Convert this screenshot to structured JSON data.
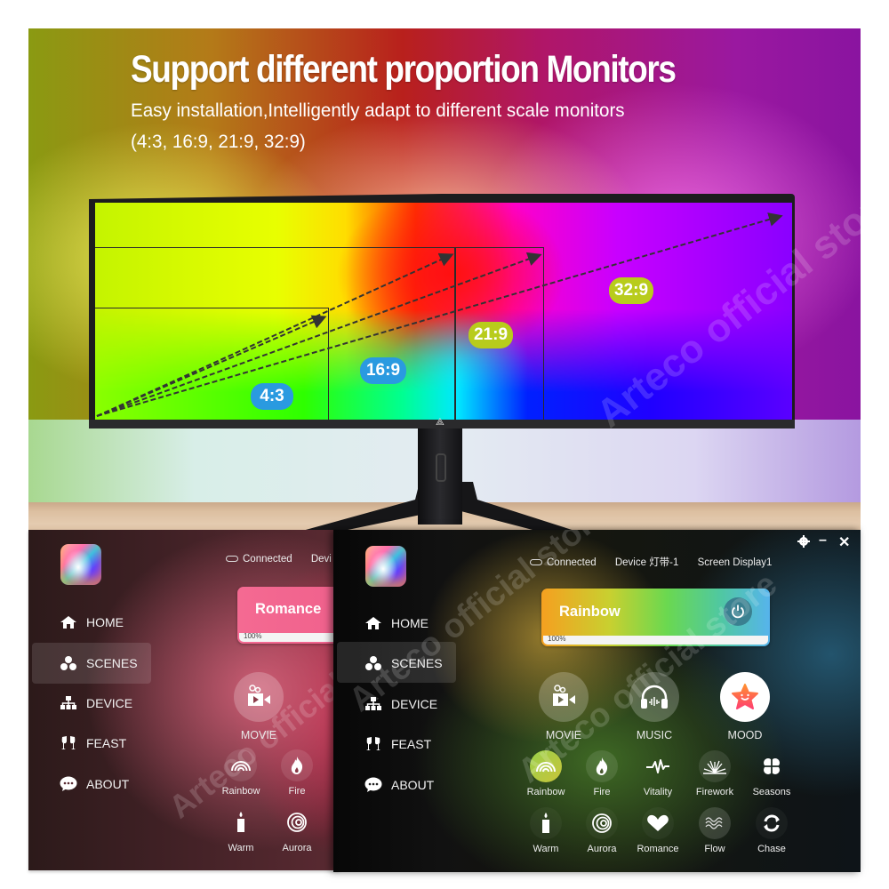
{
  "hero": {
    "title": "Support different proportion Monitors",
    "subtitle_line1": "Easy installation,Intelligently adapt to different scale monitors",
    "subtitle_line2": "(4:3, 16:9, 21:9, 32:9)",
    "watermark": "Arteco official store",
    "ratios": [
      {
        "label": "4:3",
        "color": "#2a9ae0"
      },
      {
        "label": "16:9",
        "color": "#2a9ae0"
      },
      {
        "label": "21:9",
        "color": "#b8cc1c"
      },
      {
        "label": "32:9",
        "color": "#b8cc1c"
      }
    ]
  },
  "app_left": {
    "status": {
      "connected": "Connected",
      "device_partial": "Devi"
    },
    "nav": [
      "HOME",
      "SCENES",
      "DEVICE",
      "FEAST",
      "ABOUT"
    ],
    "active_nav": "SCENES",
    "card": {
      "title": "Romance",
      "brightness": "100%",
      "color": "#f0608c"
    },
    "big_modes": [
      "MOVIE"
    ],
    "small_modes_row1": [
      "Rainbow",
      "Fire"
    ],
    "small_modes_row2": [
      "Warm",
      "Aurora"
    ]
  },
  "app_right": {
    "window_controls": {
      "settings": "settings-icon",
      "minimize": "–",
      "close": "✕"
    },
    "status": {
      "connected": "Connected",
      "device_label": "Device",
      "device_value": "灯带-1",
      "screen_label": "Screen",
      "screen_value": "Display1"
    },
    "nav": [
      "HOME",
      "SCENES",
      "DEVICE",
      "FEAST",
      "ABOUT"
    ],
    "active_nav": "SCENES",
    "card": {
      "title": "Rainbow",
      "brightness": "100%"
    },
    "big_modes": [
      "MOVIE",
      "MUSIC",
      "MOOD"
    ],
    "active_big_mode": "MOOD",
    "small_modes_row1": [
      "Rainbow",
      "Fire",
      "Vitality",
      "Firework",
      "Seasons"
    ],
    "active_small_mode": "Rainbow",
    "small_modes_row2": [
      "Warm",
      "Aurora",
      "Romance",
      "Flow",
      "Chase"
    ]
  }
}
